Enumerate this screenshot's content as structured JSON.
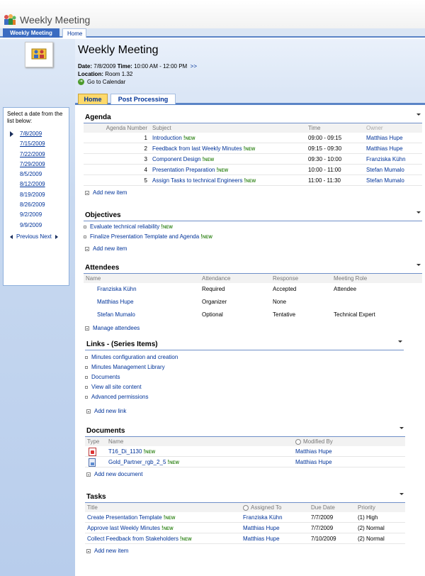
{
  "site": {
    "title": "Weekly Meeting"
  },
  "nav": {
    "tabs": [
      "Weekly Meeting",
      "Home"
    ]
  },
  "header": {
    "title": "Weekly Meeting",
    "date_label": "Date:",
    "date_value": "7/8/2009",
    "time_label": "Time:",
    "time_value": "10:00 AM - 12:00 PM",
    "more": ">>",
    "location_label": "Location:",
    "location_value": "Room 1.32",
    "calendar_link": "Go to Calendar"
  },
  "page_tabs": [
    "Home",
    "Post Processing"
  ],
  "datepicker": {
    "prompt": "Select a date from the list below:",
    "dates": [
      "7/8/2009",
      "7/15/2009",
      "7/22/2009",
      "7/29/2009",
      "8/5/2009",
      "8/12/2009",
      "8/19/2009",
      "8/26/2009",
      "9/2/2009",
      "9/9/2009"
    ],
    "previous": "Previous",
    "next": "Next"
  },
  "new_tag": "NEW",
  "agenda": {
    "title": "Agenda",
    "headers": [
      "Agenda Number",
      "Subject",
      "Time",
      "Owner"
    ],
    "rows": [
      {
        "number": "1",
        "subject": "Introduction",
        "time": "09:00 - 09:15",
        "owner": "Matthias Hupe"
      },
      {
        "number": "2",
        "subject": "Feedback from last Weekly Minutes",
        "time": "09:15 - 09:30",
        "owner": "Matthias Hupe"
      },
      {
        "number": "3",
        "subject": "Component Design",
        "time": "09:30 - 10:00",
        "owner": "Franziska Kühn"
      },
      {
        "number": "4",
        "subject": "Presentation Preparation",
        "time": "10:00 - 11:00",
        "owner": "Stefan Mumalo"
      },
      {
        "number": "5",
        "subject": "Assign Tasks to technical Engineers",
        "time": "11:00 - 11:30",
        "owner": "Stefan Mumalo"
      }
    ],
    "add": "Add new item"
  },
  "objectives": {
    "title": "Objectives",
    "items": [
      "Evaluate technical reliability",
      "Finalize Presentation Template and Agenda"
    ],
    "add": "Add new item"
  },
  "attendees": {
    "title": "Attendees",
    "headers": [
      "Name",
      "Attendance",
      "Response",
      "Meeting Role"
    ],
    "rows": [
      {
        "name": "Franziska Kühn",
        "attendance": "Required",
        "response": "Accepted",
        "role": "Attendee"
      },
      {
        "name": "Matthias Hupe",
        "attendance": "Organizer",
        "response": "None",
        "role": ""
      },
      {
        "name": "Stefan Mumalo",
        "attendance": "Optional",
        "response": "Tentative",
        "role": "Technical Expert"
      }
    ],
    "manage": "Manage attendees"
  },
  "links": {
    "title": "Links - (Series Items)",
    "items": [
      "Minutes configuration and creation",
      "Minutes Management Library",
      "Documents",
      "View all site content",
      "Advanced permissions"
    ],
    "add": "Add new link"
  },
  "documents": {
    "title": "Documents",
    "headers": [
      "Type",
      "Name",
      "Modified By"
    ],
    "rows": [
      {
        "type_icon": "pdf-file-icon",
        "name": "T16_Di_1130",
        "modified_by": "Matthias Hupe"
      },
      {
        "type_icon": "image-file-icon",
        "name": "Gold_Partner_rgb_2_5",
        "modified_by": "Matthias Hupe"
      }
    ],
    "add": "Add new document"
  },
  "tasks": {
    "title": "Tasks",
    "headers": [
      "Title",
      "Assigned To",
      "Due Date",
      "Priority"
    ],
    "rows": [
      {
        "title": "Create Presentation Template",
        "assigned": "Franziska Kühn",
        "due": "7/7/2009",
        "priority": "(1) High"
      },
      {
        "title": "Approve last Weekly Minutes",
        "assigned": "Matthias Hupe",
        "due": "7/7/2009",
        "priority": "(2) Normal"
      },
      {
        "title": "Collect Feedback from Stakeholders",
        "assigned": "Matthias Hupe",
        "due": "7/10/2009",
        "priority": "(2) Normal"
      }
    ],
    "add": "Add new item"
  }
}
